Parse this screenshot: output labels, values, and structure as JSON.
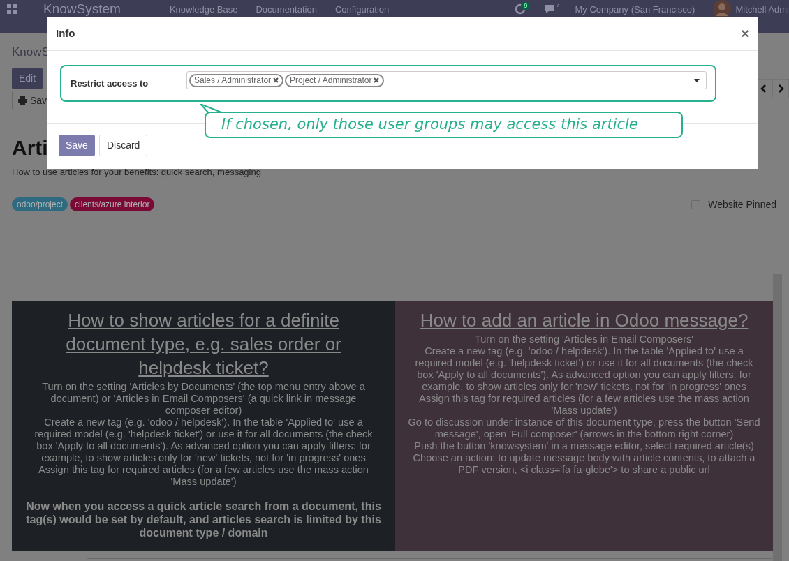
{
  "navbar": {
    "app_name": "KnowSystem",
    "menu": [
      "Knowledge Base",
      "Documentation",
      "Configuration"
    ],
    "activity_badge": "9",
    "message_badge": "7",
    "company": "My Company (San Francisco)",
    "user": "Mitchell Admi"
  },
  "breadcrumb": "KnowS",
  "buttons": {
    "edit": "Edit",
    "print": "Sav"
  },
  "article": {
    "title": "Arti",
    "subtitle": "How to use articles for your benefits: quick search, messaging",
    "tags": [
      {
        "label": "odoo/project",
        "color": "#2e6b80"
      },
      {
        "label": "clients/azure interior",
        "color": "#7a0a35"
      }
    ],
    "website_pinned": {
      "label": "Website Pinned",
      "checked": false
    },
    "sections": [
      {
        "heading": "How to show articles for a definite document type, e.g. sales order or helpdesk ticket?",
        "paragraphs": [
          "Turn on the setting 'Articles by Documents' (the top menu entry above a document) or 'Articles in Email Composers' (a quick link in message composer editor)",
          "Create a new tag (e.g. 'odoo / helpdesk'). In the table 'Applied to' use a required model (e.g. 'helpdesk ticket') or use it for all documents (the check box 'Apply to all documents'). As advanced option you can apply filters: for example, to show articles only for 'new' tickets, not for 'in progress' ones",
          "Assign this tag for required articles (for a few articles use the mass action 'Mass update')"
        ],
        "note": "Now when you access a quick article search from a document, this tag(s) would be set by default, and articles search is limited by this document type / domain",
        "color": "#1d2024"
      },
      {
        "heading": "How to add an article in Odoo message?",
        "paragraphs": [
          "Turn on the setting 'Articles in Email Composers'",
          "Create a new tag (e.g. 'odoo / helpdesk'). In the table 'Applied to' use a required model (e.g. 'helpdesk ticket') or use it for all documents (the check box 'Apply to all documents'). As advanced option you can apply filters: for example, to show articles only for 'new' tickets, not for 'in progress' ones",
          "Assign this tag for required articles (for a few articles use the mass action 'Mass update')",
          "Go to discussion under instance of this document type, press the button 'Send message', open 'Full composer' (arrows in the bottom right corner)",
          "Push the button 'knowsystem' in a message editor, select required article(s)",
          "Choose an action: to update message body with article contents, to attach a PDF version, <i class='fa fa-globe'> to share a public url"
        ],
        "color": "#3f3139"
      }
    ]
  },
  "dialog": {
    "title": "Info",
    "close": "×",
    "field": {
      "label": "Restrict access to",
      "tags": [
        "Sales / Administrator",
        "Project / Administrator"
      ]
    },
    "buttons": [
      {
        "label": "Save",
        "kind": "primary"
      },
      {
        "label": "Discard",
        "kind": "secondary"
      }
    ]
  },
  "annotation": {
    "text": "If chosen, only those user groups may access this article"
  }
}
